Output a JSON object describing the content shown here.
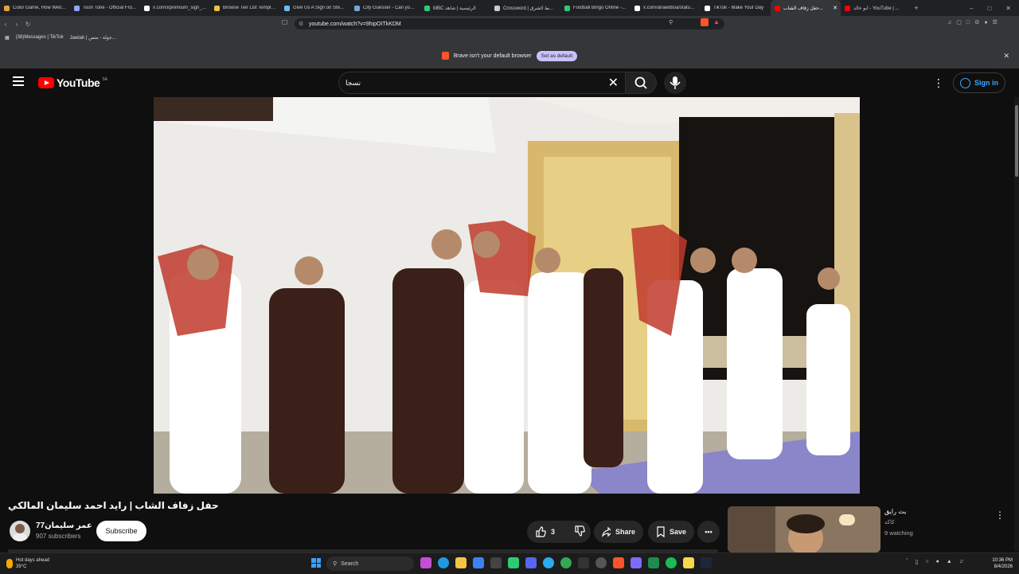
{
  "browser": {
    "tabs": [
      {
        "label": "Color Game, How Well I...",
        "color": "#e8a23c"
      },
      {
        "label": "Toon Tone - Official Fro...",
        "color": "#8fa8ff"
      },
      {
        "label": "x.com/i/premium_sign_...",
        "color": "#ffffff"
      },
      {
        "label": "Browse Tier List Templa...",
        "color": "#f0c040"
      },
      {
        "label": "Give Us A Sign on Steam",
        "color": "#66c0f4"
      },
      {
        "label": "City Guesser - Can you...",
        "color": "#6fa8dc"
      },
      {
        "label": "MBC الرئيسية | شاهد",
        "color": "#2ecc71"
      },
      {
        "label": "Crossword | الأوسط الشرق",
        "color": "#cccccc"
      },
      {
        "label": "Football Bingo Online -...",
        "color": "#2ecc71"
      },
      {
        "label": "x.com/alraedboa/status...",
        "color": "#ffffff"
      },
      {
        "label": "TikTok - Make Your Day",
        "color": "#ffffff"
      },
      {
        "label": "حفل زفاف الشاب...",
        "color": "#ff0000"
      },
      {
        "label": "أبو خالد - YouTube | ...",
        "color": "#ff0000"
      }
    ],
    "url": "youtube.com/watch?v=9hipOITkKDM",
    "bookmarks": [
      "(38)Messages | TikTok",
      "Jawlah | جولة - متص..."
    ],
    "notice_text": "Brave isn't your default browser",
    "notice_button": "Set as default"
  },
  "youtube": {
    "logo_text": "YouTube",
    "country_code": "SA",
    "search_value": "نسجا",
    "sign_in": "Sign in"
  },
  "video": {
    "title": "حفل زفاف الشاب | رايد احمد سليمان المالكي",
    "channel_name": "عمر سليمان77",
    "subscribers": "907 subscribers",
    "subscribe_label": "Subscribe",
    "likes": "3",
    "share_label": "Share",
    "save_label": "Save"
  },
  "recommended": {
    "title": "بث رايق",
    "channel": "كاكه",
    "watching": "9 watching"
  },
  "taskbar": {
    "weather_title": "Hot days ahead",
    "weather_temp": "39°C",
    "search_label": "Search",
    "time": "10:36 PM",
    "date": "8/4/2026"
  }
}
